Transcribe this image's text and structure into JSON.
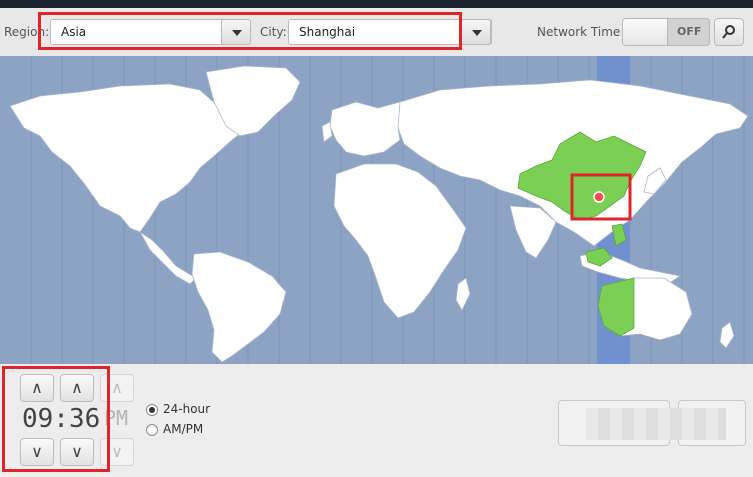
{
  "toolbar": {
    "region_label": "Region:",
    "region_value": "Asia",
    "city_label": "City:",
    "city_value": "Shanghai",
    "network_time_label": "Network Time",
    "network_time_state": "OFF",
    "locate_icon": "locate-icon"
  },
  "time": {
    "display": "09:36",
    "ampm": "PM",
    "up_glyph": "∧",
    "down_glyph": "∨",
    "format_24h_label": "24-hour",
    "format_ampm_label": "AM/PM",
    "selected_format": "24-hour"
  },
  "colors": {
    "ocean": "#8da3c4",
    "land": "#ffffff",
    "selected_zone": "#7bcf55",
    "highlight_band": "#6c8ed0",
    "annotation": "#e0242b"
  }
}
